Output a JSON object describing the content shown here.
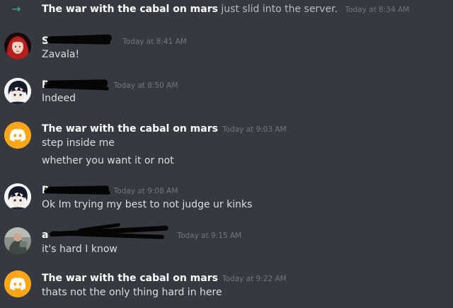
{
  "system_message": {
    "icon": "arrow-right-icon",
    "username": "The war with the cabal on mars",
    "text": "just slid into the server.",
    "timestamp": "Today at 8:34 AM"
  },
  "messages": [
    {
      "avatar": "red-hair-avatar",
      "username": "S",
      "timestamp": "Today at 8:41 AM",
      "lines": [
        "Zavala!"
      ]
    },
    {
      "avatar": "anime-boy-avatar",
      "username": "D",
      "timestamp": "Today at 8:50 AM",
      "lines": [
        "Indeed"
      ]
    },
    {
      "avatar": "discord-default-avatar",
      "username": "The war with the cabal on mars",
      "timestamp": "Today at 9:03 AM",
      "lines": [
        "step inside me",
        "whether you want it or not"
      ]
    },
    {
      "avatar": "anime-boy-avatar",
      "username": "D",
      "timestamp": "Today at 9:08 AM",
      "lines": [
        "Ok Im trying my best to not judge ur kinks"
      ]
    },
    {
      "avatar": "photo-avatar",
      "username": "a",
      "timestamp": "Today at 9:15 AM",
      "lines": [
        "it's hard I know"
      ]
    },
    {
      "avatar": "discord-default-avatar",
      "username": "The war with the cabal on mars",
      "timestamp": "Today at 9:22 AM",
      "lines": [
        "thats not the only thing hard in here"
      ]
    }
  ],
  "colors": {
    "background": "#36393f",
    "username": "#ffffff",
    "message_text": "#dcddde",
    "timestamp": "#72767d",
    "join_arrow": "#43b581",
    "discord_avatar": "#faa61a"
  }
}
